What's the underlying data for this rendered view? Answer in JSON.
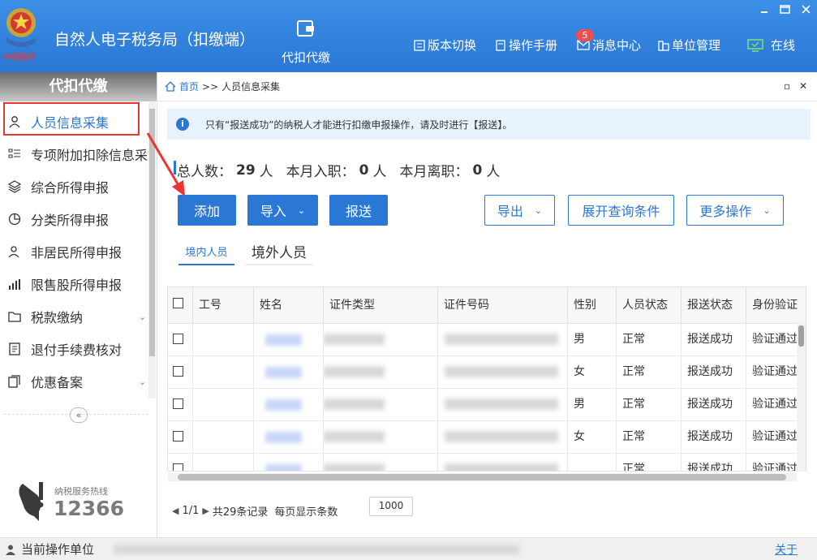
{
  "header": {
    "emblem_text": "中国税务",
    "app_title": "自然人电子税务局（扣缴端）",
    "nav_main": "代扣代缴",
    "links": [
      {
        "label": "版本切换",
        "icon": "version-switch-icon"
      },
      {
        "label": "操作手册",
        "icon": "manual-icon"
      },
      {
        "label": "消息中心",
        "icon": "mail-icon",
        "badge": "5"
      },
      {
        "label": "单位管理",
        "icon": "unit-manage-icon"
      },
      {
        "label": "在线",
        "icon": "monitor-online-icon"
      }
    ],
    "window_controls": [
      "minimize",
      "maximize",
      "close"
    ]
  },
  "sidebar": {
    "title": "代扣代缴",
    "items": [
      {
        "label": "人员信息采集",
        "icon": "person-icon",
        "active": true
      },
      {
        "label": "专项附加扣除信息采集",
        "icon": "list-icon"
      },
      {
        "label": "综合所得申报",
        "icon": "layers-icon"
      },
      {
        "label": "分类所得申报",
        "icon": "pie-chart-icon"
      },
      {
        "label": "非居民所得申报",
        "icon": "person-outline-icon"
      },
      {
        "label": "限售股所得申报",
        "icon": "bar-chart-icon"
      },
      {
        "label": "税款缴纳",
        "icon": "folder-icon",
        "expandable": true
      },
      {
        "label": "退付手续费核对",
        "icon": "document-icon"
      },
      {
        "label": "优惠备案",
        "icon": "copy-icon",
        "expandable": true
      }
    ],
    "collapse_symbol": "«",
    "hotline_label": "纳税服务热线",
    "hotline_number": "12366"
  },
  "content": {
    "breadcrumb": {
      "home": "首页",
      "sep": ">>",
      "current": "人员信息采集"
    },
    "notice": "只有“报送成功”的纳税人才能进行扣缴申报操作，请及时进行【报送】。",
    "stats": {
      "total_label": "总人数：",
      "total": "29",
      "unit1": "人",
      "hire_label": "本月入职：",
      "hire": "0",
      "unit2": "人",
      "leave_label": "本月离职：",
      "leave": "0",
      "unit3": "人"
    },
    "buttons": {
      "add": "添加",
      "import": "导入",
      "submit": "报送",
      "export": "导出",
      "expand_query": "展开查询条件",
      "more": "更多操作"
    },
    "tabs": {
      "domestic": "境内人员",
      "foreign": "境外人员"
    },
    "table": {
      "headers": [
        "工号",
        "姓名",
        "证件类型",
        "证件号码",
        "性别",
        "人员状态",
        "报送状态",
        "身份验证"
      ],
      "rows": [
        {
          "gender": "男",
          "status": "正常",
          "report": "报送成功",
          "verify": "验证通过"
        },
        {
          "gender": "女",
          "status": "正常",
          "report": "报送成功",
          "verify": "验证通过"
        },
        {
          "gender": "男",
          "status": "正常",
          "report": "报送成功",
          "verify": "验证通过"
        },
        {
          "gender": "女",
          "status": "正常",
          "report": "报送成功",
          "verify": "验证通过"
        },
        {
          "gender": "",
          "status": "正常",
          "report": "报送成功",
          "verify": "验证通过"
        }
      ]
    },
    "pager": {
      "page": "1/1",
      "total": "共29条记录",
      "per_page_label": "每页显示条数",
      "per_page": "1000"
    }
  },
  "status_bar": {
    "label": "当前操作单位",
    "about": "关于"
  },
  "colors": {
    "brand": "#2a77d6",
    "alert_red": "#e33333",
    "notice_bg": "#e8f2fd"
  }
}
